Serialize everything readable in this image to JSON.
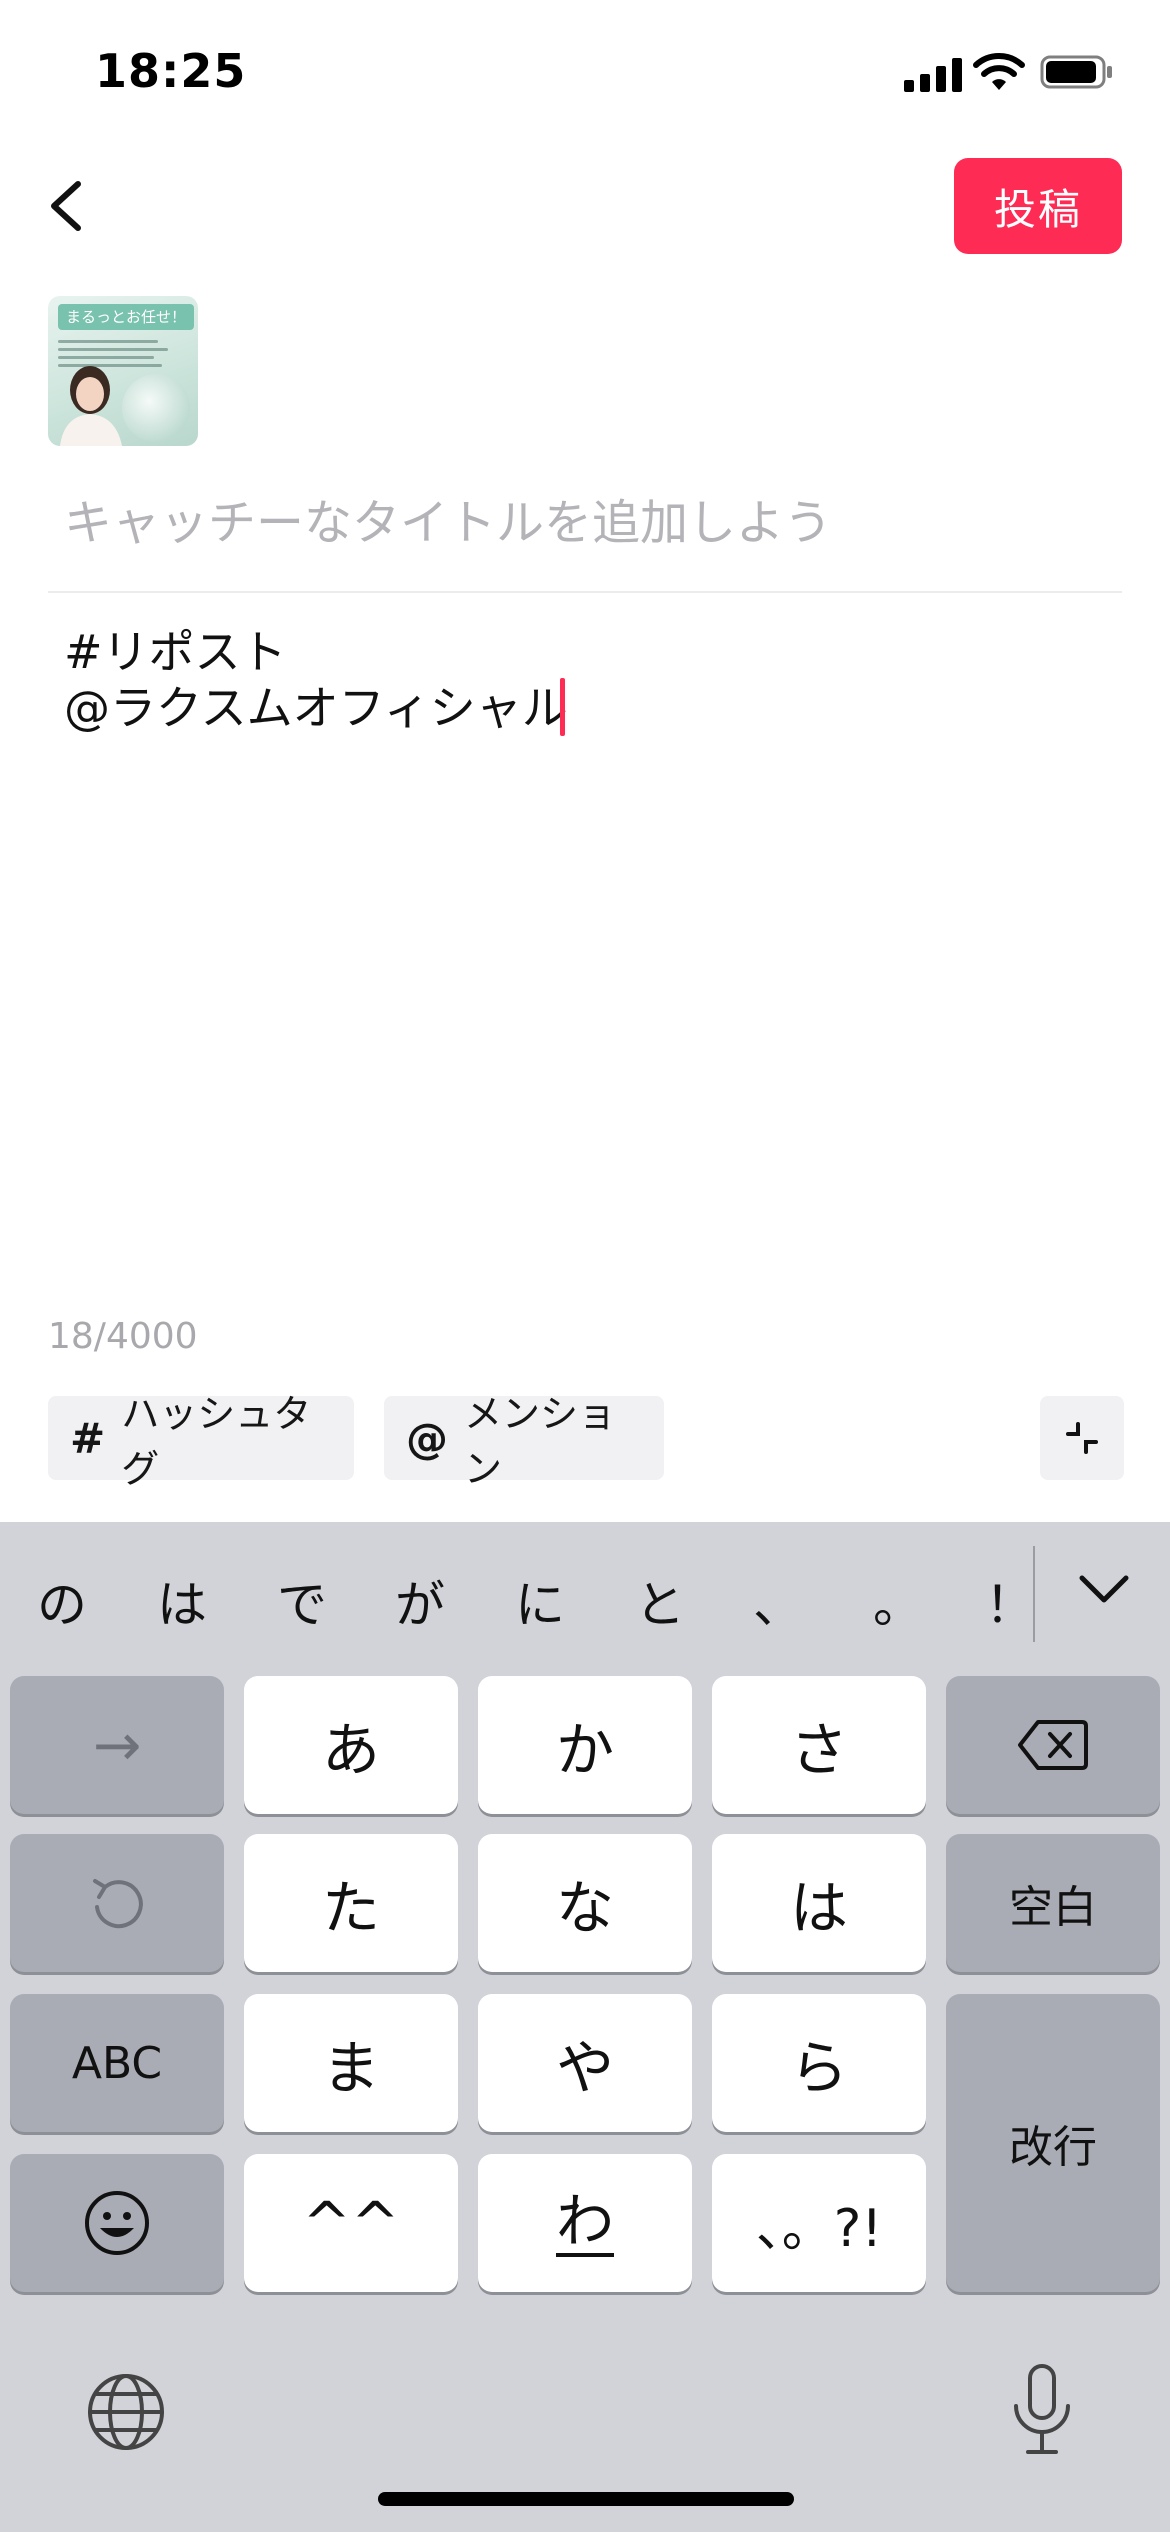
{
  "status": {
    "time": "18:25"
  },
  "header": {
    "post_label": "投稿"
  },
  "thumbnail": {
    "banner_text": "まるっとお任せ！"
  },
  "title": {
    "placeholder": "キャッチーなタイトルを追加しよう"
  },
  "body": {
    "lines": [
      "#リポスト",
      "@ラクスムオフィシャル"
    ]
  },
  "counter": "18/4000",
  "chips": {
    "hashtag": {
      "symbol": "#",
      "label": "ハッシュタグ"
    },
    "mention": {
      "symbol": "@",
      "label": "メンション"
    }
  },
  "keyboard": {
    "suggestions": [
      "の",
      "は",
      "で",
      "が",
      "に",
      "と",
      "、",
      "。",
      "！"
    ],
    "rows": [
      [
        "→",
        "あ",
        "か",
        "さ",
        "delete"
      ],
      [
        "undo",
        "た",
        "な",
        "は",
        "空白"
      ],
      [
        "ABC",
        "ま",
        "や",
        "ら",
        "改行"
      ],
      [
        "emoji",
        "^^",
        "わ",
        "、。?!"
      ]
    ],
    "labels": {
      "arrow": "→",
      "a": "あ",
      "ka": "か",
      "sa": "さ",
      "ta": "た",
      "na": "な",
      "ha": "は",
      "space": "空白",
      "abc": "ABC",
      "ma": "ま",
      "ya": "や",
      "ra": "ら",
      "return": "改行",
      "kaomoji": "^^",
      "wa": "わ",
      "punct": "、。?!"
    }
  },
  "colors": {
    "accent": "#fe2c55",
    "keyboard_bg": "#d1d3d9",
    "key_gray": "#a9acb5"
  }
}
